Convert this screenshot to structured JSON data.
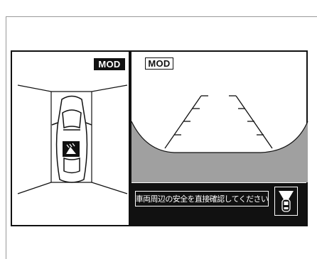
{
  "overlay": {
    "top_view_badge": "MOD",
    "rear_view_badge": "MOD",
    "warning_message": "車両周辺の安全を直接確認してください"
  },
  "icons": {
    "top_view_car": "car-top-view-icon",
    "parking_sensor": "parking-sensor-icon",
    "rear_camera": "rear-camera-car-icon"
  },
  "colors": {
    "ground_gray": "#a0a0a0",
    "line": "#111111",
    "warning_bar": "#111111"
  }
}
